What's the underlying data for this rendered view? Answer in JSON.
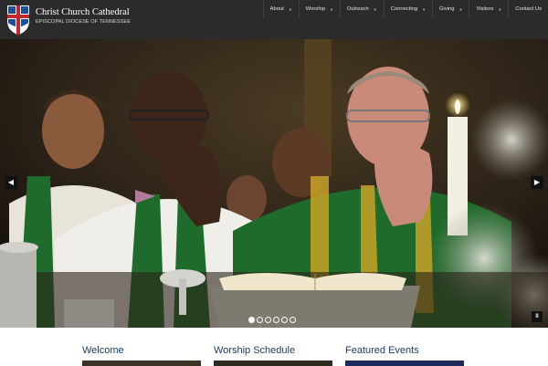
{
  "site": {
    "title": "Christ Church Cathedral",
    "subtitle": "EPISCOPAL DIOCESE OF TENNESSEE"
  },
  "nav": [
    {
      "label": "About",
      "has_dropdown": true
    },
    {
      "label": "Worship",
      "has_dropdown": true
    },
    {
      "label": "Outreach",
      "has_dropdown": true
    },
    {
      "label": "Connecting",
      "has_dropdown": true
    },
    {
      "label": "Giving",
      "has_dropdown": true
    },
    {
      "label": "Visitors",
      "has_dropdown": true
    },
    {
      "label": "Contact Us",
      "has_dropdown": false
    }
  ],
  "slider": {
    "slide_count": 6,
    "active_index": 0,
    "prev_icon": "chevron-left-icon",
    "next_icon": "chevron-right-icon",
    "pause_icon": "pause-icon"
  },
  "sections": [
    {
      "heading": "Welcome"
    },
    {
      "heading": "Worship Schedule"
    },
    {
      "heading": "Featured Events"
    }
  ],
  "colors": {
    "header_bg": "#2b2b2b",
    "heading": "#1d3b66",
    "vestment_green": "#1f6b2c",
    "gold_trim": "#c9a227"
  }
}
